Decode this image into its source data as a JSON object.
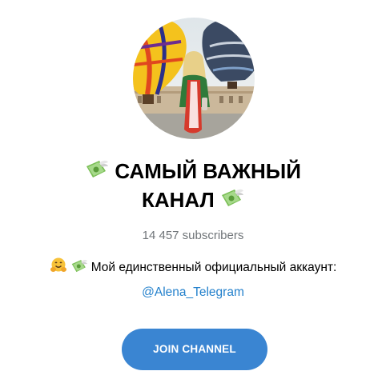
{
  "channel": {
    "title_line1": "САМЫЙ ВАЖНЫЙ",
    "title_line2": "КАНАЛ",
    "title_emoji": "money-with-wings-icon",
    "subscribers": "14 457 subscribers",
    "description_emojis": [
      "hugging-face-icon",
      "money-with-wings-icon"
    ],
    "description": "Мой единственный официальный аккаунт:",
    "mention": "@Alena_Telegram"
  },
  "actions": {
    "join_label": "JOIN CHANNEL"
  },
  "colors": {
    "link": "#2481cc",
    "button": "#3a85d2",
    "muted": "#707579"
  }
}
